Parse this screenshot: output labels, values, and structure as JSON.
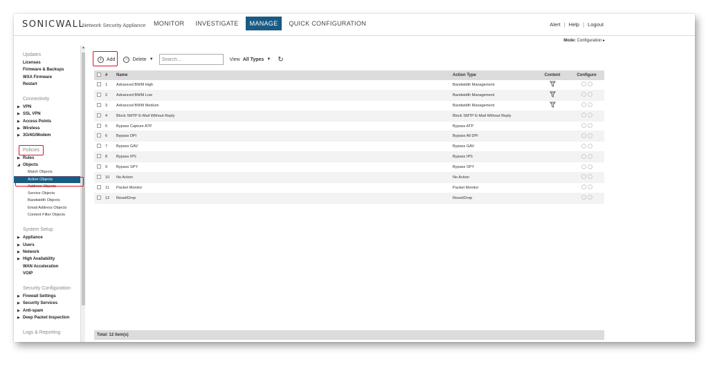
{
  "header": {
    "logo": "SONICWALL",
    "subtitle": "Network Security Appliance",
    "nav": [
      "MONITOR",
      "INVESTIGATE",
      "MANAGE",
      "QUICK CONFIGURATION"
    ],
    "active_nav": "MANAGE",
    "links": [
      "Alert",
      "Help",
      "Logout"
    ],
    "mode_label": "Mode:",
    "mode_value": "Configuration ▸"
  },
  "sidebar": {
    "updates_title": "Updates",
    "updates": [
      "Licenses",
      "Firmware & Backups",
      "WXA Firmware",
      "Restart"
    ],
    "connectivity_title": "Connectivity",
    "connectivity": [
      "VPN",
      "SSL VPN",
      "Access Points",
      "Wireless",
      "3G/4G/Modem"
    ],
    "policies_title": "Policies",
    "rules": "Rules",
    "objects": "Objects",
    "object_items": [
      "Match Objects",
      "Action Objects",
      "Address Objects",
      "Service Objects",
      "Bandwidth Objects",
      "Email Address Objects",
      "Content Filter Objects"
    ],
    "system_title": "System Setup",
    "system": [
      "Appliance",
      "Users",
      "Network",
      "High Availability"
    ],
    "system_plain": [
      "WAN Acceleration",
      "VOIP"
    ],
    "security_title": "Security Configuration",
    "security": [
      "Firewall Settings",
      "Security Services",
      "Anti-spam",
      "Deep Packet Inspection"
    ],
    "logs_title": "Logs & Reporting"
  },
  "toolbar": {
    "add_label": "Add",
    "delete_label": "Delete",
    "search_placeholder": "Search...",
    "view_label": "View",
    "view_value": "All Types"
  },
  "table": {
    "headers": {
      "num": "#",
      "name": "Name",
      "type": "Action Type",
      "content": "Content",
      "configure": "Configure"
    },
    "rows": [
      {
        "num": "1",
        "name": "Advanced BWM High",
        "type": "Bandwidth Management",
        "content": true
      },
      {
        "num": "2",
        "name": "Advanced BWM Low",
        "type": "Bandwidth Management",
        "content": true
      },
      {
        "num": "3",
        "name": "Advanced BWM Medium",
        "type": "Bandwidth Management",
        "content": true
      },
      {
        "num": "4",
        "name": "Block SMTP E-Mail Without Reply",
        "type": "Block SMTP E-Mail Without Reply",
        "content": false
      },
      {
        "num": "5",
        "name": "Bypass Capture ATP",
        "type": "Bypass ATP",
        "content": false
      },
      {
        "num": "6",
        "name": "Bypass DPI",
        "type": "Bypass All DPI",
        "content": false
      },
      {
        "num": "7",
        "name": "Bypass GAV",
        "type": "Bypass GAV",
        "content": false
      },
      {
        "num": "8",
        "name": "Bypass IPS",
        "type": "Bypass IPS",
        "content": false
      },
      {
        "num": "9",
        "name": "Bypass SPY",
        "type": "Bypass SPY",
        "content": false
      },
      {
        "num": "10",
        "name": "No Action",
        "type": "No Action",
        "content": false
      },
      {
        "num": "11",
        "name": "Packet Monitor",
        "type": "Packet Monitor",
        "content": false
      },
      {
        "num": "12",
        "name": "Reset/Drop",
        "type": "Reset/Drop",
        "content": false
      }
    ],
    "total": "Total: 12 item(s)"
  },
  "colors": {
    "accent": "#1a5b83",
    "highlight": "#d9111d"
  }
}
